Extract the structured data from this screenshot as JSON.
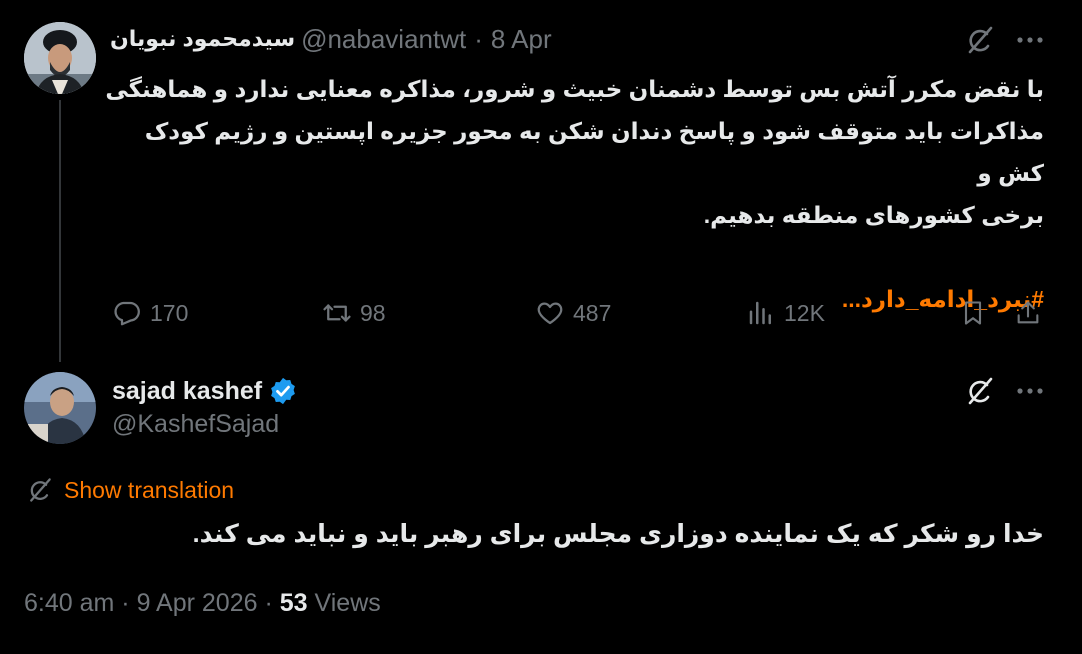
{
  "colors": {
    "background": "#000000",
    "text": "#e7e9ea",
    "muted": "#71767b",
    "accent": "#ff7a00",
    "verified": "#1d9bf0"
  },
  "parent_tweet": {
    "display_name": "سیدمحمود نبویان",
    "handle": "@nabaviantwt",
    "separator": "·",
    "date": "8 Apr",
    "text_lines": [
      "با نقض مکرر آتش بس توسط دشمنان خبیث و شرور، مذاکره معنایی ندارد و هماهنگی",
      "مذاکرات باید متوقف شود و پاسخ دندان شکن به محور جزیره اپستین و رژیم کودک کش و",
      "برخی کشورهای منطقه بدهیم."
    ],
    "hashtag": "#نبرد_ادامه_دارد...",
    "stats": {
      "replies": "170",
      "retweets": "98",
      "likes": "487",
      "views": "12K"
    },
    "icons": [
      "grok-icon",
      "more-icon",
      "reply-icon",
      "retweet-icon",
      "like-icon",
      "views-icon",
      "bookmark-icon",
      "share-icon"
    ]
  },
  "reply_tweet": {
    "display_name": "sajad kashef",
    "handle": "@KashefSajad",
    "show_translation": "Show translation",
    "text": "خدا رو شکر که یک نماینده دوزاری مجلس برای رهبر باید و نباید می کند.",
    "time": "6:40 am",
    "separator": "·",
    "date": "9 Apr 2026",
    "views_count": "53",
    "views_label": "Views"
  }
}
